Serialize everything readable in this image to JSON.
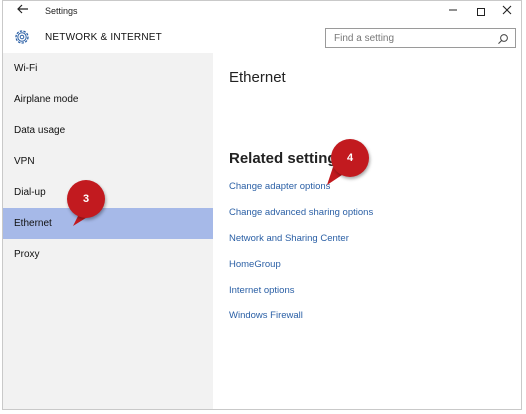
{
  "window": {
    "title": "Settings",
    "back_icon": "back-arrow-icon",
    "min_label": "—",
    "close_label": "✕"
  },
  "header": {
    "section_title": "NETWORK & INTERNET",
    "search_placeholder": "Find a setting"
  },
  "sidebar": {
    "items": [
      {
        "label": "Wi-Fi",
        "selected": false
      },
      {
        "label": "Airplane mode",
        "selected": false
      },
      {
        "label": "Data usage",
        "selected": false
      },
      {
        "label": "VPN",
        "selected": false
      },
      {
        "label": "Dial-up",
        "selected": false
      },
      {
        "label": "Ethernet",
        "selected": true
      },
      {
        "label": "Proxy",
        "selected": false
      }
    ]
  },
  "main": {
    "page_title": "Ethernet",
    "related_heading": "Related settings",
    "links": [
      "Change adapter options",
      "Change advanced sharing options",
      "Network and Sharing Center",
      "HomeGroup",
      "Internet options",
      "Windows Firewall"
    ]
  },
  "callouts": [
    {
      "label": "3"
    },
    {
      "label": "4"
    }
  ],
  "colors": {
    "selected_bg": "#a6b9e8",
    "sidebar_bg": "#f2f2f2",
    "link": "#2a5fa5",
    "callout": "#c21a1f"
  }
}
